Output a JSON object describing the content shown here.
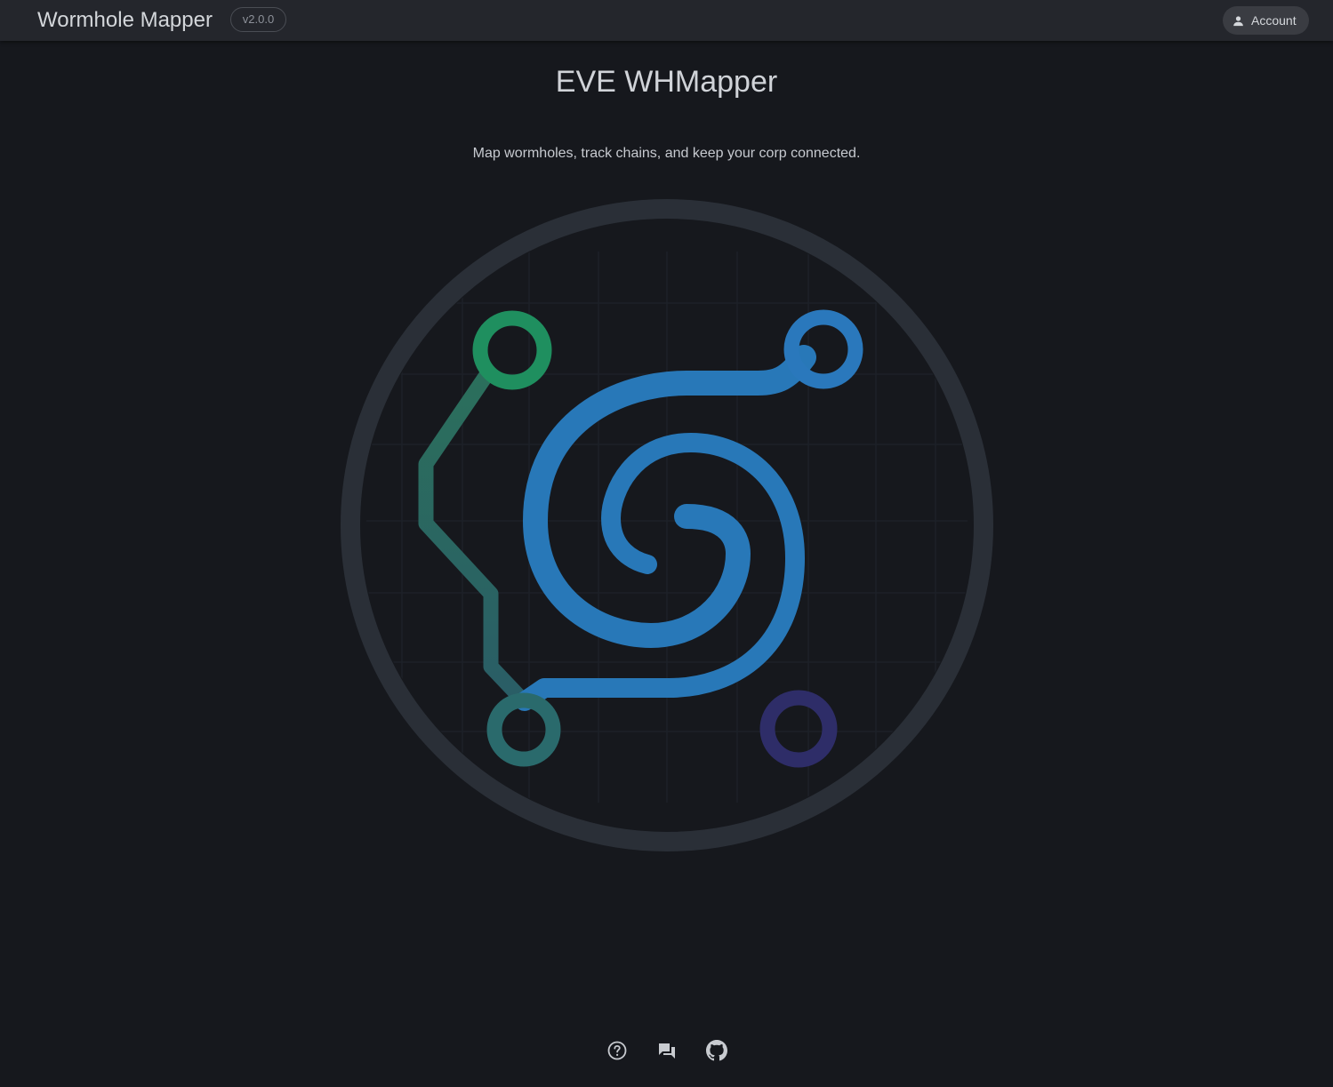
{
  "header": {
    "app_title": "Wormhole Mapper",
    "version": "v2.0.0",
    "account_label": "Account",
    "account_icon": "person-icon"
  },
  "main": {
    "title": "EVE WHMapper",
    "tagline": "Map wormholes, track chains, and keep your corp connected.",
    "logo": {
      "icon": "wormhole-spiral-logo",
      "colors": {
        "ring": "#2a2f37",
        "spiral": "#2878b8",
        "node_green": "#1f8f5f",
        "node_teal": "#2a6a6c",
        "node_blue": "#2a78bc",
        "node_purple": "#2e2d68"
      }
    }
  },
  "footer": {
    "links": [
      {
        "icon": "help-icon"
      },
      {
        "icon": "chat-icon"
      },
      {
        "icon": "github-icon"
      }
    ]
  },
  "theme": {
    "background": "#16181d",
    "header_background": "#24262c"
  }
}
